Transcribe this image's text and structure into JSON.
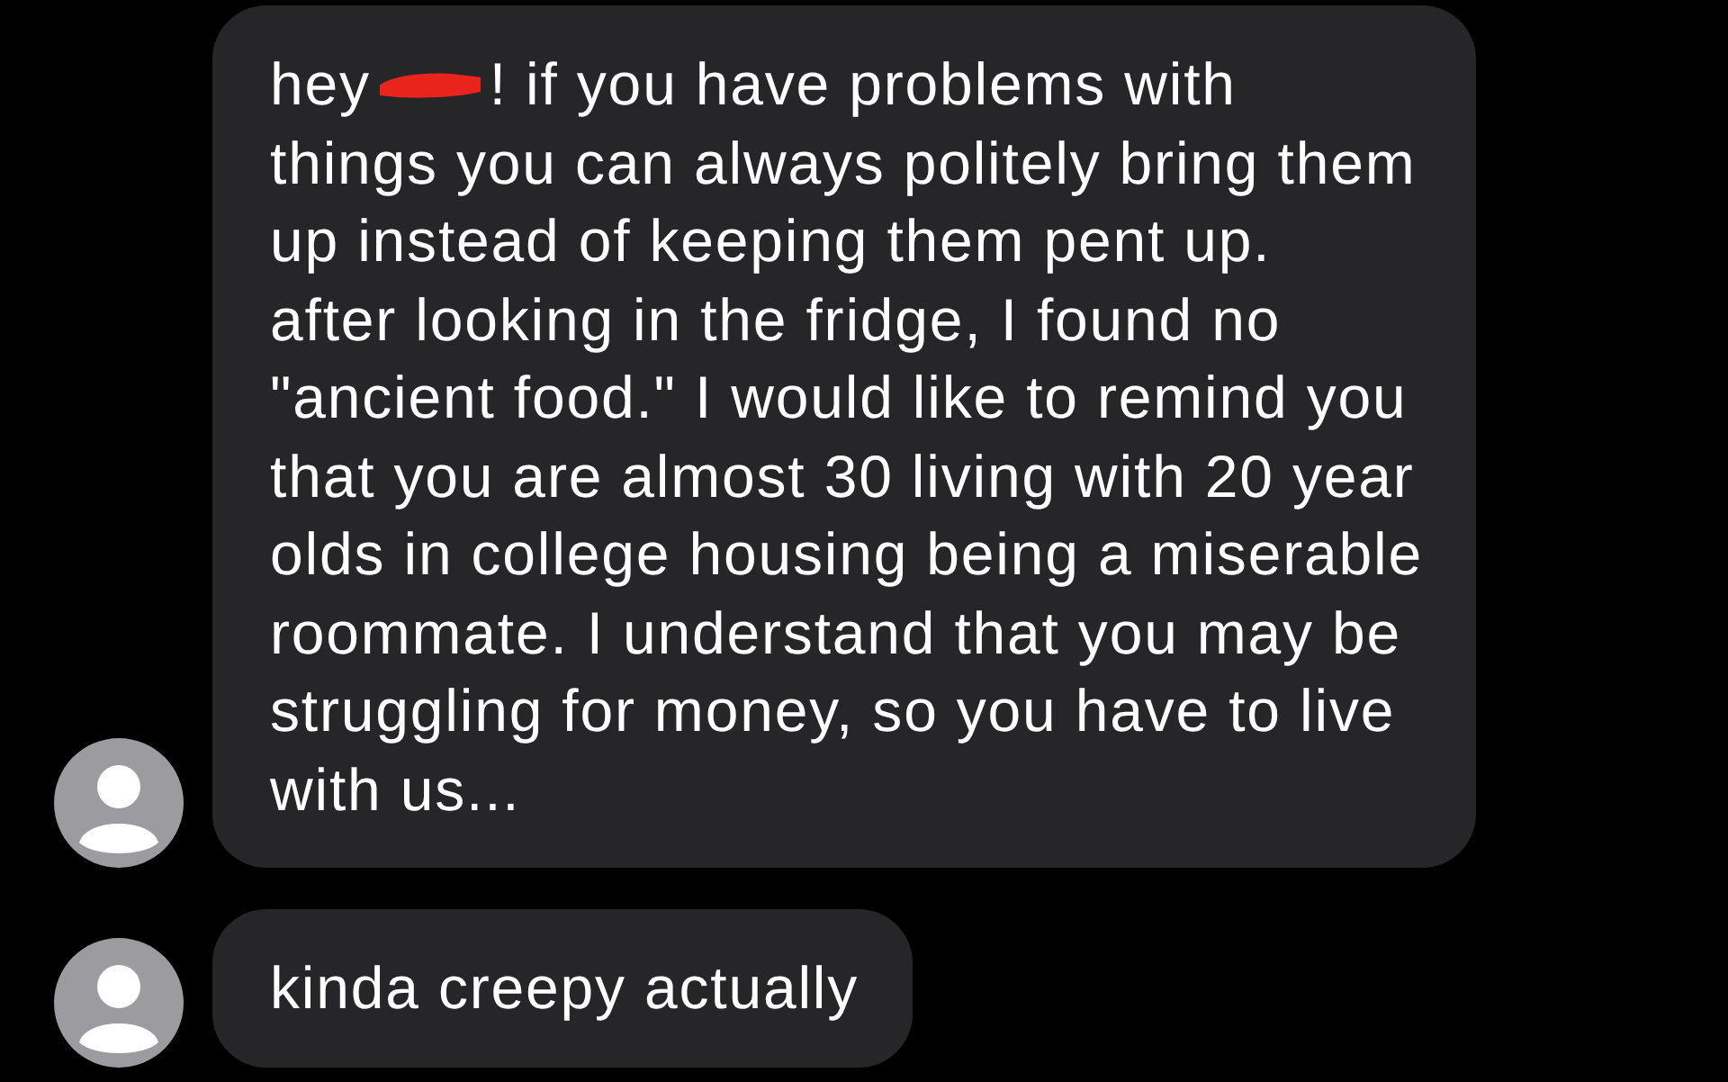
{
  "messages": [
    {
      "opening": "hey",
      "redacted": true,
      "lines": [
        "! if you have problems with",
        "things you can always politely bring them",
        "up instead of keeping them pent up.",
        "after looking in the fridge, I found no",
        "\"ancient food.\" I would like to remind you",
        "that you are almost 30 living with 20 year",
        "olds in college housing being a miserable",
        "roommate. I understand that you may be",
        "struggling for money, so you have to live",
        "with us..."
      ]
    },
    {
      "redacted": false,
      "lines": [
        "kinda creepy actually"
      ]
    }
  ]
}
